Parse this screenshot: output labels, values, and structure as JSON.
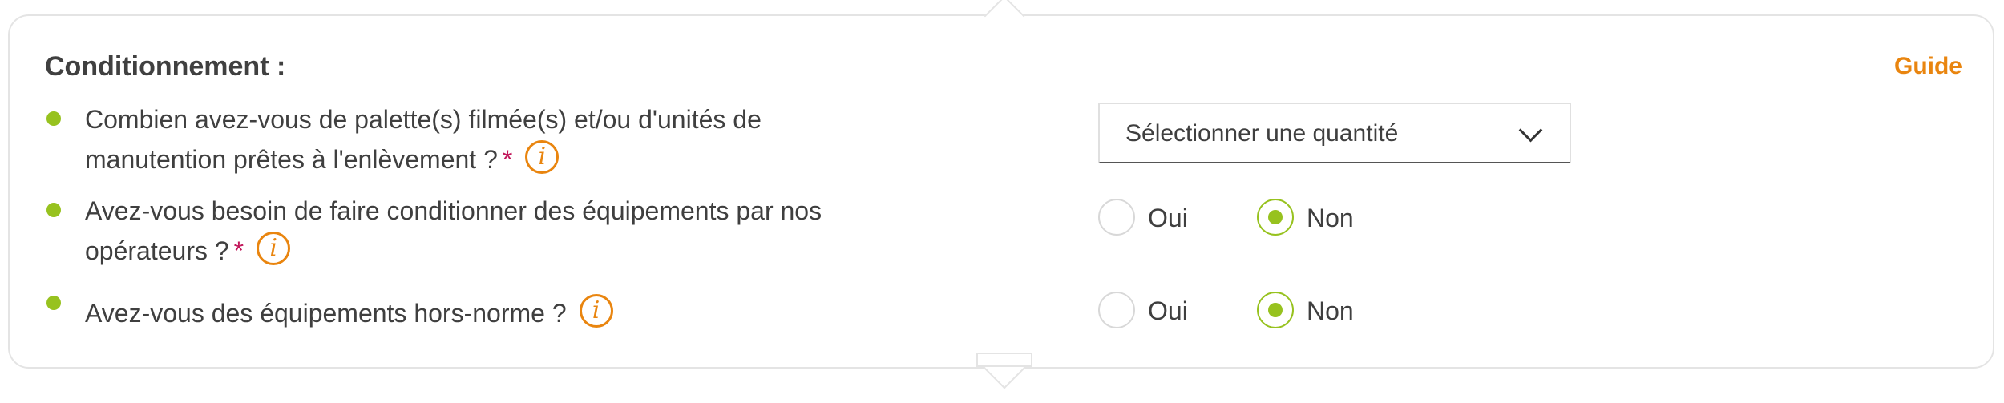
{
  "section": {
    "title": "Conditionnement :",
    "guide_link": "Guide"
  },
  "questions": [
    {
      "line1": "Combien avez-vous de palette(s) filmée(s) et/ou d'unités de",
      "line2": "manutention prêtes à l'enlèvement ?",
      "required": "*",
      "info_icon": "i"
    },
    {
      "line1": "Avez-vous besoin de faire conditionner des équipements par nos",
      "line2": "opérateurs ?",
      "required": "*",
      "info_icon": "i"
    },
    {
      "line1": "Avez-vous des équipements hors-norme ?",
      "info_icon": "i"
    }
  ],
  "quantity_select": {
    "placeholder": "Sélectionner une quantité"
  },
  "radios": [
    {
      "yes": "Oui",
      "no": "Non",
      "selected": "Non"
    },
    {
      "yes": "Oui",
      "no": "Non",
      "selected": "Non"
    }
  ],
  "colors": {
    "accent_green": "#97c21f",
    "accent_orange": "#e9850f",
    "required_red": "#c2185b"
  }
}
